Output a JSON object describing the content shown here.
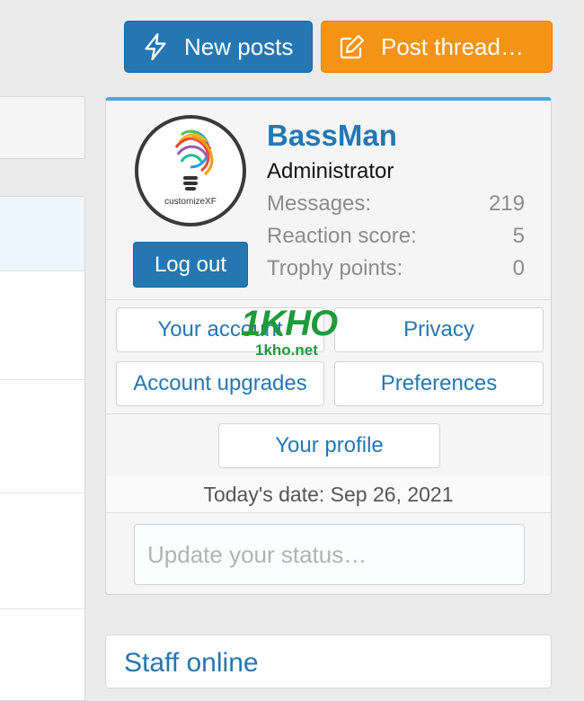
{
  "header": {
    "new_posts_label": "New posts",
    "post_thread_label": "Post thread…"
  },
  "account": {
    "avatar_text": "customizeXF",
    "username": "BassMan",
    "role": "Administrator",
    "logout_label": "Log out",
    "stats": [
      {
        "label": "Messages:",
        "value": "219"
      },
      {
        "label": "Reaction score:",
        "value": "5"
      },
      {
        "label": "Trophy points:",
        "value": "0"
      }
    ],
    "links": {
      "your_account": "Your account",
      "privacy": "Privacy",
      "account_upgrades": "Account upgrades",
      "preferences": "Preferences",
      "your_profile": "Your profile"
    },
    "date_text": "Today's date: Sep 26, 2021",
    "status_placeholder": "Update your status…"
  },
  "watermark": {
    "logo": "1KHO",
    "url": "1kho.net"
  },
  "staff_online": {
    "title": "Staff online"
  },
  "colors": {
    "primary": "#2577b1",
    "accent_orange": "#f49416",
    "menu_top_border": "#47a7eb",
    "watermark_green": "#1f9a3b"
  },
  "icons": {
    "new_posts": "bolt-icon",
    "post_thread": "edit-icon"
  }
}
